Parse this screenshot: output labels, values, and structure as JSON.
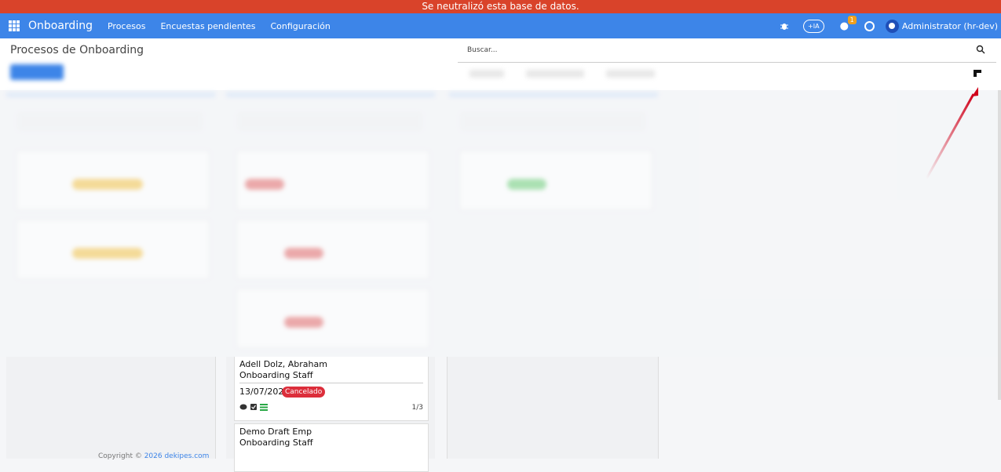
{
  "banner": {
    "text": "Se neutralizó esta base de datos."
  },
  "navbar": {
    "brand": "Onboarding",
    "menu": [
      "Procesos",
      "Encuestas pendientes",
      "Configuración"
    ],
    "ia_label": "+IA",
    "chat_count": "1",
    "user": "Administrator (hr-dev)"
  },
  "page": {
    "title": "Procesos de Onboarding"
  },
  "search": {
    "placeholder": "Buscar..."
  },
  "cards": [
    {
      "name": "Adell Dolz, Abraham",
      "role": "Onboarding Staff",
      "date": "13/07/2026",
      "status": "Cancelado",
      "progress": "1/3"
    },
    {
      "name": "Demo Draft Emp",
      "role": "Onboarding Staff"
    }
  ],
  "footer": {
    "text": "Copyright © ",
    "link": "2026 dekipes.com"
  },
  "colors": {
    "navbar": "#3d85e8",
    "banner": "#d9432a",
    "cancel_badge": "#dc2e3b",
    "annotation_arrow": "#d0021b"
  }
}
